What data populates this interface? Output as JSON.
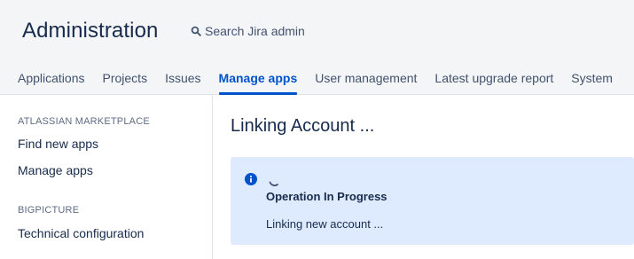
{
  "header": {
    "title": "Administration",
    "search_label": "Search Jira admin"
  },
  "tabs": [
    {
      "label": "Applications",
      "active": false
    },
    {
      "label": "Projects",
      "active": false
    },
    {
      "label": "Issues",
      "active": false
    },
    {
      "label": "Manage apps",
      "active": true
    },
    {
      "label": "User management",
      "active": false
    },
    {
      "label": "Latest upgrade report",
      "active": false
    },
    {
      "label": "System",
      "active": false
    }
  ],
  "sidebar": {
    "sections": [
      {
        "heading": "ATLASSIAN MARKETPLACE",
        "items": [
          "Find new apps",
          "Manage apps"
        ]
      },
      {
        "heading": "BIGPICTURE",
        "items": [
          "Technical configuration"
        ]
      }
    ]
  },
  "main": {
    "title": "Linking Account ...",
    "message": {
      "title": "Operation In Progress",
      "body": "Linking new account ..."
    }
  },
  "colors": {
    "accent": "#0052cc",
    "header_bg": "#f4f5f7",
    "info_bg": "#deebff",
    "text": "#172b4d"
  }
}
